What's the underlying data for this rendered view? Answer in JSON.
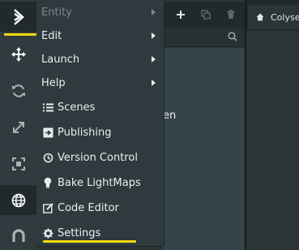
{
  "toolbar": {
    "buttons": [
      {
        "icon": "logo-icon",
        "active": true
      },
      {
        "icon": "move-icon"
      },
      {
        "icon": "rotate-icon"
      },
      {
        "icon": "scale-icon"
      },
      {
        "icon": "resize-icon"
      },
      {
        "icon": "world-icon",
        "active": true
      },
      {
        "icon": "magnet-icon"
      }
    ]
  },
  "hierarchy": {
    "header_icons": [
      "add-icon",
      "duplicate-icon",
      "delete-icon"
    ],
    "partial_text": "en"
  },
  "viewport": {
    "tab_label": "Colyse"
  },
  "menu": {
    "entity_label": "Entity",
    "edit_label": "Edit",
    "launch_label": "Launch",
    "help_label": "Help",
    "scenes_label": "Scenes",
    "publishing_label": "Publishing",
    "version_control_label": "Version Control",
    "bake_lightmaps_label": "Bake LightMaps",
    "code_editor_label": "Code Editor",
    "settings_label": "Settings"
  },
  "colors": {
    "accent_underline": "#f5d90a",
    "menu_bg": "#2e3a3e",
    "disabled_text": "#7c888c"
  }
}
